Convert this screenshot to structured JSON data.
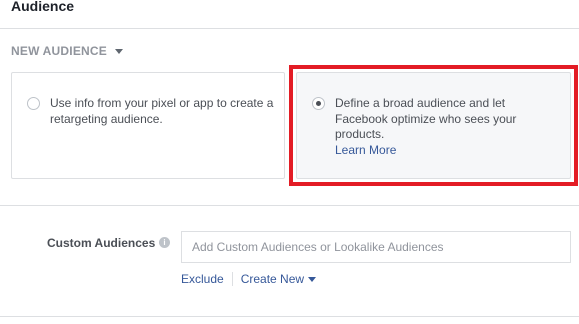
{
  "section": {
    "title": "Audience"
  },
  "audience_dropdown": {
    "label": "NEW AUDIENCE"
  },
  "options": [
    {
      "text": "Use info from your pixel or app to create a retargeting audience.",
      "selected": false
    },
    {
      "text": "Define a broad audience and let Facebook optimize who sees your products.",
      "link": "Learn More",
      "selected": true
    }
  ],
  "custom_audiences": {
    "label": "Custom Audiences",
    "info_icon": "i",
    "placeholder": "Add Custom Audiences or Lookalike Audiences",
    "exclude_label": "Exclude",
    "create_new_label": "Create New"
  },
  "colors": {
    "highlight": "#e31c25",
    "link": "#365899",
    "border": "#dddfe2",
    "selected_bg": "#f6f7f9"
  },
  "icons": {
    "dropdown": "caret-down-icon",
    "info": "info-icon",
    "radio": "radio-icon"
  }
}
